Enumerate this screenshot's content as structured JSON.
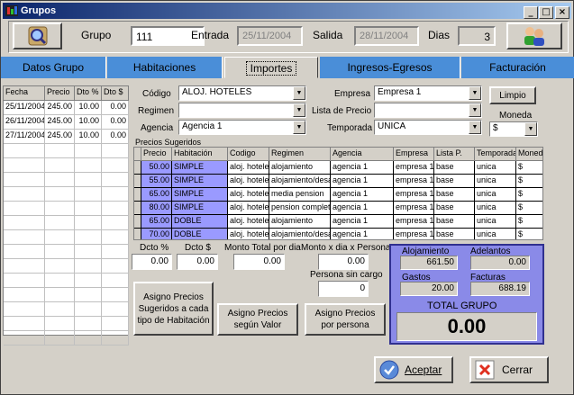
{
  "window": {
    "title": "Grupos"
  },
  "top": {
    "grupo_label": "Grupo",
    "grupo_value": "111",
    "entrada_label": "Entrada",
    "entrada_value": "25/11/2004",
    "salida_label": "Salida",
    "salida_value": "28/11/2004",
    "dias_label": "Dias",
    "dias_value": "3"
  },
  "tabs": [
    "Datos Grupo",
    "Habitaciones",
    "Importes",
    "Ingresos-Egresos",
    "Facturación"
  ],
  "left_grid": {
    "columns": [
      "Fecha",
      "Precio",
      "Dto %",
      "Dto $"
    ],
    "rows": [
      [
        "25/11/2004",
        "245.00",
        "10.00",
        "0.00"
      ],
      [
        "26/11/2004",
        "245.00",
        "10.00",
        "0.00"
      ],
      [
        "27/11/2004",
        "245.00",
        "10.00",
        "0.00"
      ]
    ]
  },
  "filters": {
    "codigo_label": "Código",
    "codigo_value": "ALOJ. HOTELES",
    "regimen_label": "Regimen",
    "regimen_value": "",
    "agencia_label": "Agencia",
    "agencia_value": "Agencia 1",
    "empresa_label": "Empresa",
    "empresa_value": "Empresa 1",
    "lista_label": "Lista de Precio",
    "lista_value": "",
    "temporada_label": "Temporada",
    "temporada_value": "UNICA",
    "limpio_label": "Limpio",
    "moneda_label": "Moneda",
    "moneda_value": "$"
  },
  "precios": {
    "title": "Precios Sugeridos",
    "columns": [
      "Precio",
      "Habitación",
      "Codigo",
      "Regimen",
      "Agencia",
      "Empresa",
      "Lista P.",
      "Temporada",
      "Moneda"
    ],
    "rows": [
      [
        "50.00",
        "SIMPLE",
        "aloj. hoteles",
        "alojamiento",
        "agencia 1",
        "empresa 1",
        "base",
        "unica",
        "$"
      ],
      [
        "55.00",
        "SIMPLE",
        "aloj. hoteles",
        "alojamiento/desayuno",
        "agencia 1",
        "empresa 1",
        "base",
        "unica",
        "$"
      ],
      [
        "65.00",
        "SIMPLE",
        "aloj. hoteles",
        "media pension",
        "agencia 1",
        "empresa 1",
        "base",
        "unica",
        "$"
      ],
      [
        "80.00",
        "SIMPLE",
        "aloj. hoteles",
        "pension completa",
        "agencia 1",
        "empresa 1",
        "base",
        "unica",
        "$"
      ],
      [
        "65.00",
        "DOBLE",
        "aloj. hoteles",
        "alojamiento",
        "agencia 1",
        "empresa 1",
        "base",
        "unica",
        "$"
      ],
      [
        "70.00",
        "DOBLE",
        "aloj. hoteles",
        "alojamiento/desayuno",
        "agencia 1",
        "empresa 1",
        "base",
        "unica",
        "$"
      ]
    ]
  },
  "discounts": {
    "dto_pct_label": "Dcto %",
    "dto_pct_value": "0.00",
    "dto_amt_label": "Dcto $",
    "dto_amt_value": "0.00",
    "monto_dia_label": "Monto Total por dia",
    "monto_dia_value": "0.00",
    "monto_persona_label": "Monto x dia x Persona",
    "monto_persona_value": "0.00",
    "persona_sin_cargo_label": "Persona sin cargo",
    "persona_sin_cargo_value": "0"
  },
  "buttons": {
    "asigno_tipo": "Asigno Precios Sugeridos a cada tipo de Habitación",
    "asigno_valor": "Asigno Precios según Valor",
    "asigno_persona": "Asigno Precios por persona",
    "aceptar": "Aceptar",
    "cerrar": "Cerrar"
  },
  "totals": {
    "alojamiento_label": "Alojamiento",
    "alojamiento_value": "661.50",
    "adelantos_label": "Adelantos",
    "adelantos_value": "0.00",
    "gastos_label": "Gastos",
    "gastos_value": "20.00",
    "facturas_label": "Facturas",
    "facturas_value": "688.19",
    "total_label": "TOTAL GRUPO",
    "total_value": "0.00"
  },
  "colors": {
    "tab_blue": "#4a8ed8",
    "highlight": "#9a9aff",
    "total_panel": "#8a8ae8"
  }
}
